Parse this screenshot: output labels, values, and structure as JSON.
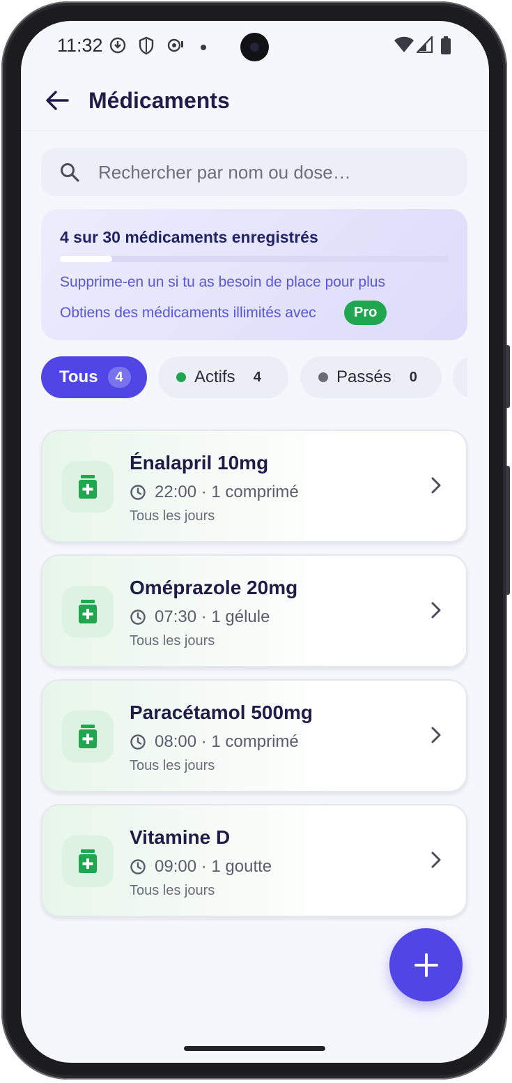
{
  "status_bar": {
    "time": "11:32"
  },
  "header": {
    "title": "Médicaments"
  },
  "search": {
    "placeholder": "Rechercher par nom ou dose…"
  },
  "quota": {
    "title": "4 sur 30 médicaments enregistrés",
    "used": 4,
    "limit": 30,
    "line1": "Supprime-en un si tu as besoin de place pour plus",
    "line2": "Obtiens des médicaments illimités avec",
    "pro_badge": "Pro"
  },
  "filters": [
    {
      "label": "Tous",
      "count": "4",
      "active": true
    },
    {
      "label": "Actifs",
      "count": "4",
      "dot_color": "#1fa64f"
    },
    {
      "label": "Passés",
      "count": "0",
      "dot_color": "#6b6b78"
    }
  ],
  "medications": [
    {
      "name": "Énalapril 10mg",
      "schedule": "22:00 · 1 comprimé",
      "frequency": "Tous les jours"
    },
    {
      "name": "Oméprazole 20mg",
      "schedule": "07:30 · 1 gélule",
      "frequency": "Tous les jours"
    },
    {
      "name": "Paracétamol 500mg",
      "schedule": "08:00 · 1 comprimé",
      "frequency": "Tous les jours"
    },
    {
      "name": "Vitamine D",
      "schedule": "09:00 · 1 goutte",
      "frequency": "Tous les jours"
    }
  ],
  "colors": {
    "accent": "#4f46e5",
    "pro_green": "#1fa64f",
    "pill_green": "#1fa64f",
    "title_text": "#1f1d47"
  },
  "icons": {
    "back": "arrow-left-icon",
    "search": "search-icon",
    "clock": "clock-icon",
    "chevron": "chevron-right-icon",
    "medicine": "medicine-bottle-icon",
    "add": "plus-icon"
  }
}
